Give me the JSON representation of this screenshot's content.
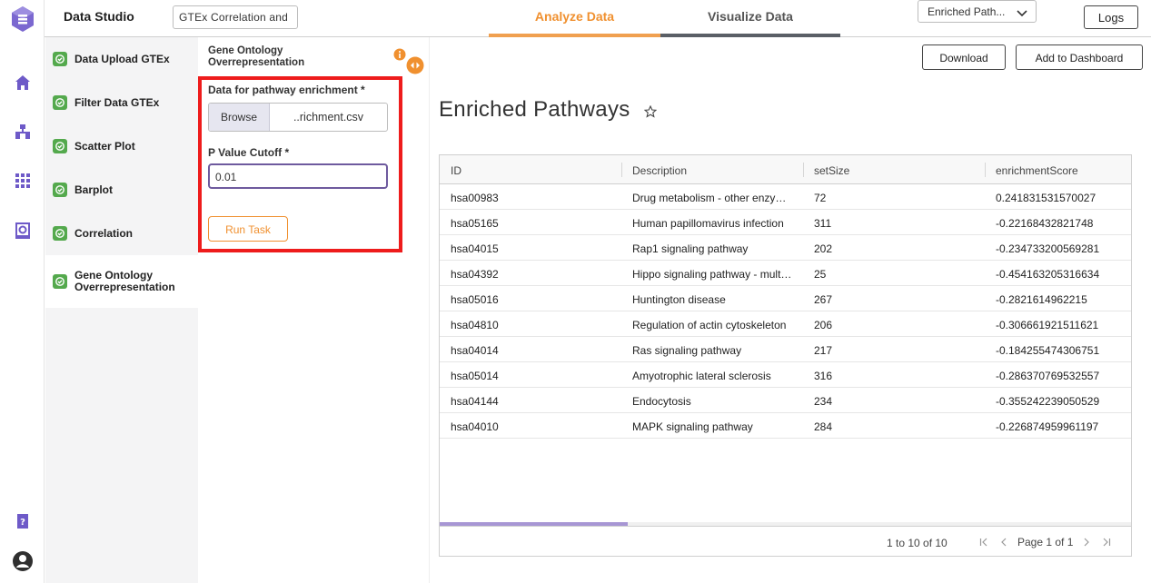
{
  "app": {
    "title": "Data Studio",
    "project_name": "GTEx Correlation and"
  },
  "tabs": [
    {
      "label": "Analyze Data",
      "active": true
    },
    {
      "label": "Visualize Data",
      "active": false
    }
  ],
  "result_select": {
    "value": "Enriched Path..."
  },
  "logs_button": "Logs",
  "rail_icons": [
    "logo-icon",
    "home-icon",
    "workflow-icon",
    "apps-grid-icon",
    "database-icon",
    "help-icon",
    "user-icon"
  ],
  "steps": [
    {
      "label": "Data Upload GTEx",
      "complete": true
    },
    {
      "label": "Filter Data GTEx",
      "complete": true
    },
    {
      "label": "Scatter Plot",
      "complete": true
    },
    {
      "label": "Barplot",
      "complete": true
    },
    {
      "label": "Correlation",
      "complete": true
    },
    {
      "label": "Gene Ontology Overrepresentation",
      "complete": true
    }
  ],
  "config": {
    "title": "Gene Ontology Overrepresentation",
    "file_label": "Data for pathway enrichment *",
    "browse_label": "Browse",
    "file_name": "..richment.csv",
    "pvalue_label": "P Value Cutoff *",
    "pvalue_value": "0.01",
    "run_label": "Run Task"
  },
  "main": {
    "download_label": "Download",
    "add_dashboard_label": "Add to Dashboard",
    "title": "Enriched Pathways"
  },
  "table": {
    "columns": [
      "ID",
      "Description",
      "setSize",
      "enrichmentScore"
    ],
    "rows": [
      [
        "hsa00983",
        "Drug metabolism - other enzymes",
        "72",
        "0.241831531570027"
      ],
      [
        "hsa05165",
        "Human papillomavirus infection",
        "311",
        "-0.22168432821748"
      ],
      [
        "hsa04015",
        "Rap1 signaling pathway",
        "202",
        "-0.234733200569281"
      ],
      [
        "hsa04392",
        "Hippo signaling pathway - multiple species",
        "25",
        "-0.454163205316634"
      ],
      [
        "hsa05016",
        "Huntington disease",
        "267",
        "-0.2821614962215"
      ],
      [
        "hsa04810",
        "Regulation of actin cytoskeleton",
        "206",
        "-0.306661921511621"
      ],
      [
        "hsa04014",
        "Ras signaling pathway",
        "217",
        "-0.184255474306751"
      ],
      [
        "hsa05014",
        "Amyotrophic lateral sclerosis",
        "316",
        "-0.286370769532557"
      ],
      [
        "hsa04144",
        "Endocytosis",
        "234",
        "-0.355242239050529"
      ],
      [
        "hsa04010",
        "MAPK signaling pathway",
        "284",
        "-0.226874959961197"
      ]
    ],
    "row_count": "1 to 10 of 10",
    "page_text": "Page 1 of 1"
  },
  "colors": {
    "accent_orange": "#f0902f",
    "brand_purple": "#6e5ac8",
    "check_green": "#54a94d",
    "highlight_red": "#ee1c1c"
  }
}
